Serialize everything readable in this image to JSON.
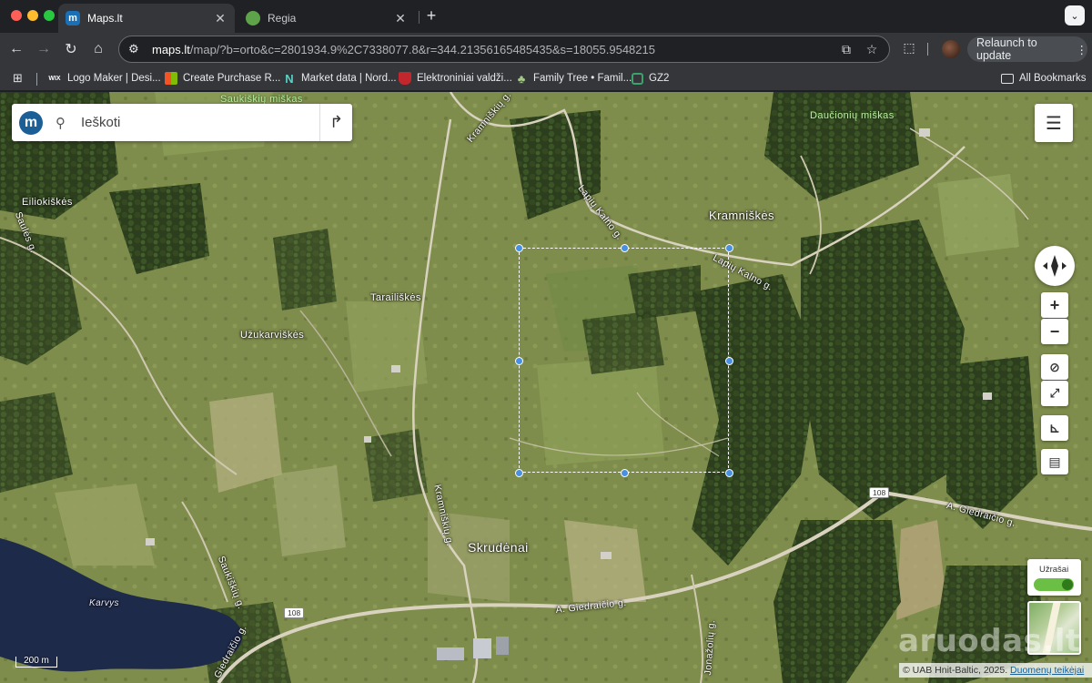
{
  "browser": {
    "tabs": [
      {
        "title": "Maps.lt",
        "favicon": "m",
        "active": true
      },
      {
        "title": "Regia",
        "favicon": "",
        "active": false
      }
    ],
    "new_tab_symbol": "+",
    "url_domain": "maps.lt",
    "url_path": "/map/?b=orto&c=2801934.9%2C7338077.8&r=344.21356165485435&s=18055.9548215",
    "relaunch_label": "Relaunch to update",
    "bookmarks": [
      {
        "label": "Logo Maker | Desi...",
        "icon": "wix-icon",
        "icon_text": "WIX"
      },
      {
        "label": "Create Purchase R...",
        "icon": "microsoft-icon",
        "icon_text": ""
      },
      {
        "label": "Market data | Nord...",
        "icon": "nordpool-icon",
        "icon_text": "N"
      },
      {
        "label": "Elektroniniai valdži...",
        "icon": "coat-of-arms-icon",
        "icon_text": ""
      },
      {
        "label": "Family Tree • Famil...",
        "icon": "tree-icon",
        "icon_text": ""
      },
      {
        "label": "GZ2",
        "icon": "gz-icon",
        "icon_text": ""
      }
    ],
    "all_bookmarks_label": "All Bookmarks"
  },
  "map": {
    "search": {
      "placeholder": "Ieškoti",
      "logo_letter": "m"
    },
    "labels": {
      "saukiskiu_miskas": "Saukiškių miškas",
      "dauciuniu_miskas": "Daučionių miškas",
      "eiliokiskes": "Eiliokiškės",
      "kramniskes": "Kramniškės",
      "tarailiskes": "Tarailiškės",
      "uzukarviskes": "Užukarviškės",
      "skrudenai": "Skrudėnai",
      "karvys": "Karvys",
      "kramniskiu_g_top": "Kramniškių g.",
      "kramniskiu_g_bottom": "Kramniškių g.",
      "lapiu_kalno_g_1": "Lapių Kalno g.",
      "lapiu_kalno_g_2": "Lapių Kalno g.",
      "sauliu_g": "Saulės g.",
      "saukiskiu_g": "Saukiškių g.",
      "a_giedraicio_g_east": "A. Giedraičio g.",
      "a_giedraicio_g_west": "A. Giedraičio g.",
      "jonazoliu_g": "Jonažolių g.",
      "giedraicio_g_sw": "Giedraičio g."
    },
    "road_numbers": {
      "east": "108",
      "west": "108"
    },
    "notes_label": "Užrašai",
    "notes_enabled": true,
    "watermark": "aruodas.lt",
    "scale_label": "200 m",
    "attribution_text": "© UAB Hnit-Baltic, 2025.",
    "attribution_link": "Duomenų teikėjai"
  }
}
